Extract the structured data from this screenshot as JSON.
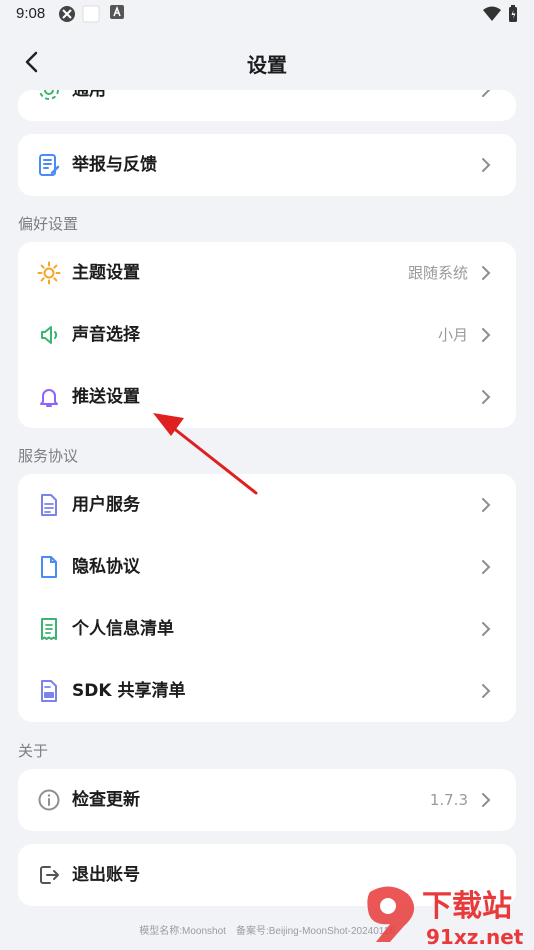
{
  "status_bar": {
    "time": "9:08"
  },
  "header": {
    "title": "设置"
  },
  "card_top": {
    "general_label": "通用"
  },
  "card_feedback": {
    "label": "举报与反馈"
  },
  "preferences": {
    "section_title": "偏好设置",
    "theme": {
      "label": "主题设置",
      "value": "跟随系统"
    },
    "sound": {
      "label": "声音选择",
      "value": "小月"
    },
    "push": {
      "label": "推送设置"
    }
  },
  "service": {
    "section_title": "服务协议",
    "user_service": "用户服务",
    "privacy": "隐私协议",
    "personal_info": "个人信息清单",
    "sdk": "SDK 共享清单"
  },
  "about": {
    "section_title": "关于",
    "update": {
      "label": "检查更新",
      "value": "1.7.3"
    }
  },
  "logout": {
    "label": "退出账号"
  },
  "footer": {
    "text": "模型名称:Moonshot　备案号:Beijing-MoonShot-20240116"
  },
  "watermark": {
    "brand": "下载站",
    "site": "91xz.net"
  },
  "colors": {
    "background": "#f2f3f7",
    "card": "#ffffff",
    "arrow": "#e02020",
    "icon_blue": "#4a8bf5",
    "icon_orange": "#f5a623",
    "icon_green": "#3cb371",
    "icon_purple": "#8e63ff"
  }
}
